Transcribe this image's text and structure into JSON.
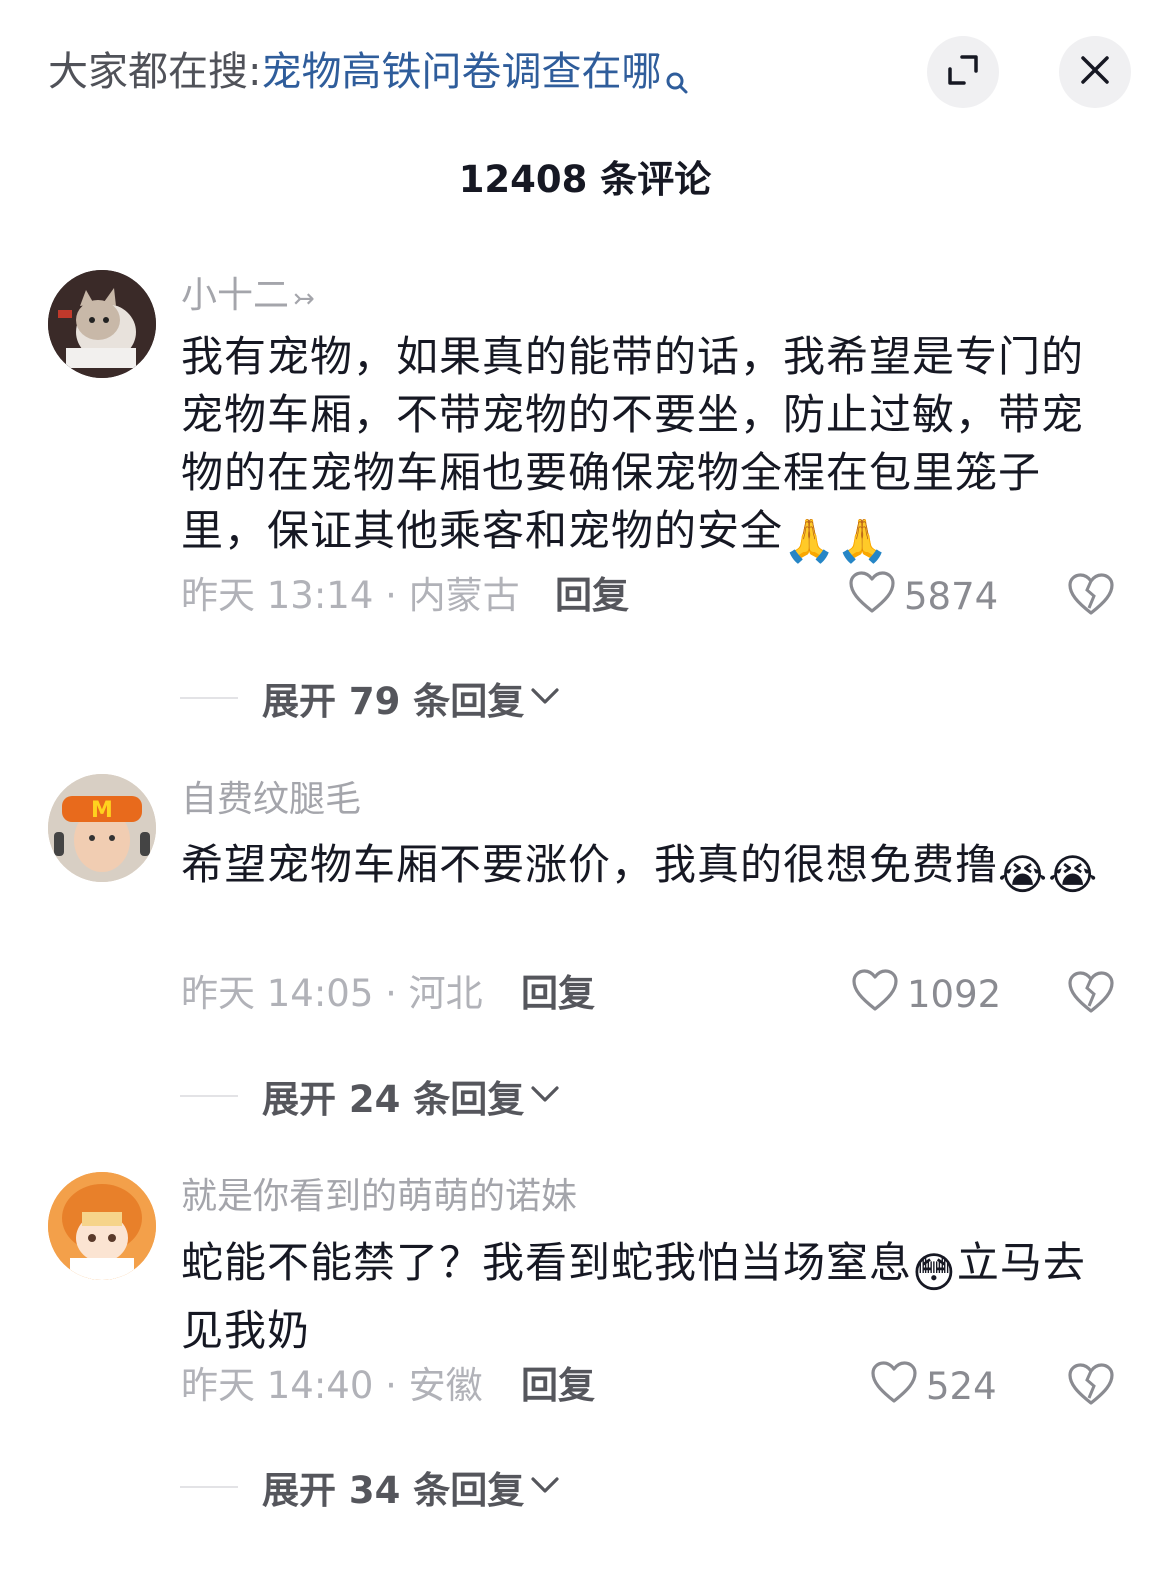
{
  "header": {
    "search_prefix": "大家都在搜:",
    "search_query": "宠物高铁问卷调查在哪",
    "icons": {
      "search": "search-icon",
      "expand": "expand-icon",
      "close": "close-icon"
    }
  },
  "comment_count_title": "12408 条评论",
  "comments": [
    {
      "username": "小十二",
      "username_arrow": "↣",
      "text": "我有宠物，如果真的能带的话，我希望是专门的宠物车厢，不带宠物的不要坐，防止过敏，带宠物的在宠物车厢也要确保宠物全程在包里笼子里，保证其他乘客和宠物的安全",
      "emoji": "🙏🙏",
      "meta": "昨天 13:14 · 内蒙古",
      "reply_label": "回复",
      "likes": "5874",
      "expand_label": "展开 79 条回复"
    },
    {
      "username": "自费纹腿毛",
      "text": "希望宠物车厢不要涨价，我真的很想免费撸",
      "emoji": "😭😭",
      "meta": "昨天 14:05 · 河北",
      "reply_label": "回复",
      "likes": "1092",
      "expand_label": "展开 24 条回复"
    },
    {
      "username": "就是你看到的萌萌的诺妹",
      "text_before": "蛇能不能禁了？我看到蛇我怕当场窒息",
      "emoji": "😳",
      "text_after": "立马去见我奶",
      "meta": "昨天 14:40 · 安徽",
      "reply_label": "回复",
      "likes": "524",
      "expand_label": "展开 34 条回复"
    }
  ],
  "colors": {
    "link": "#2f5d9b",
    "text": "#161823",
    "muted": "#a4a5ab",
    "button_bg": "#f0f0f2"
  }
}
